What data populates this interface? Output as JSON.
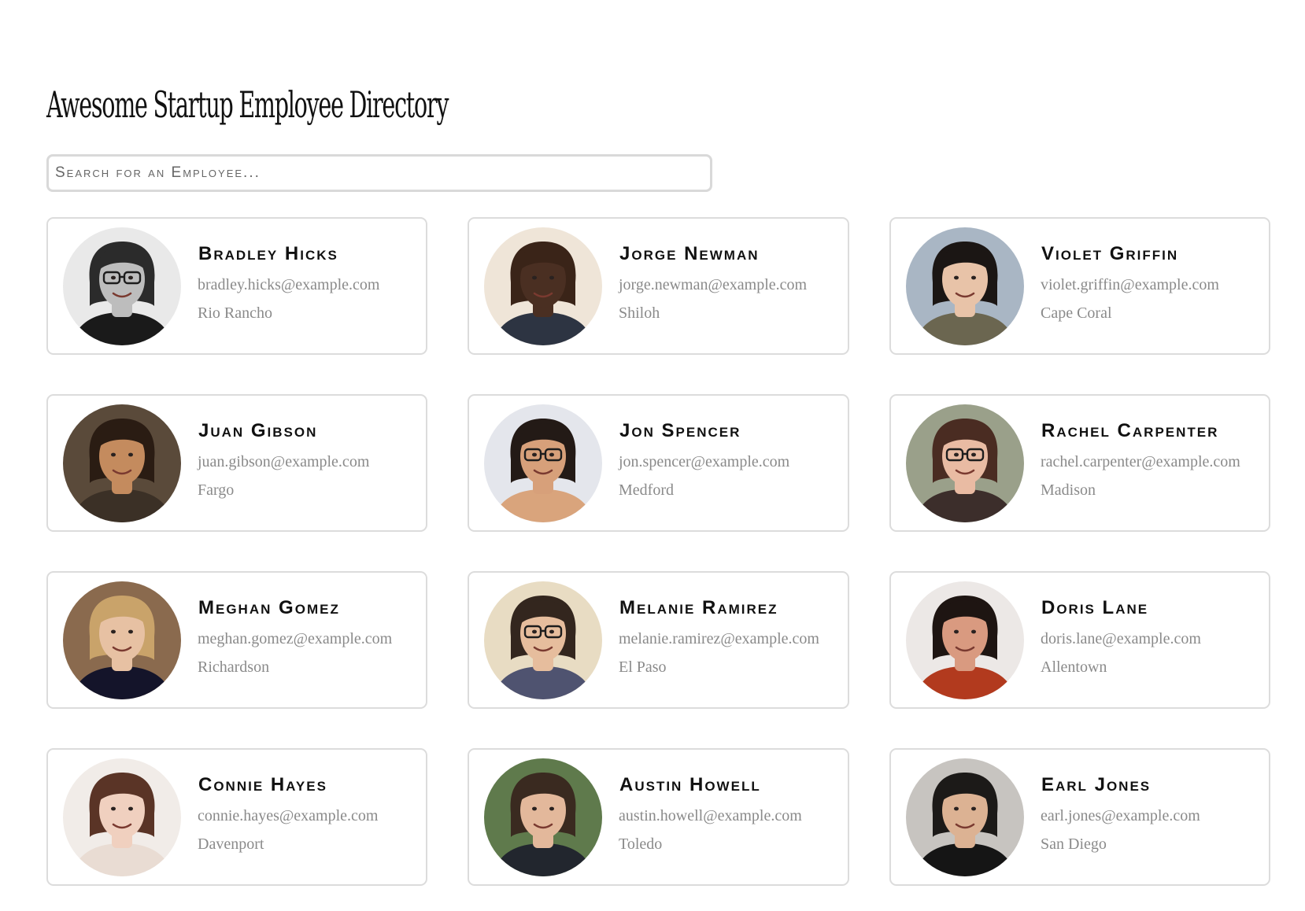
{
  "header": {
    "title": "Awesome Startup Employee Directory"
  },
  "search": {
    "placeholder": "Search for an Employee...",
    "value": ""
  },
  "employees": [
    {
      "name": "Bradley Hicks",
      "email": "bradley.hicks@example.com",
      "city": "Rio Rancho",
      "photo": {
        "bg": "#e9e9e9",
        "skin": "#bdbdbd",
        "hair": "#2b2b2b",
        "shirt": "#1a1a1a",
        "glasses": true
      }
    },
    {
      "name": "Jorge Newman",
      "email": "jorge.newman@example.com",
      "city": "Shiloh",
      "photo": {
        "bg": "#efe5d8",
        "skin": "#4a2f22",
        "hair": "#3a2418",
        "shirt": "#2d3442",
        "glasses": false
      }
    },
    {
      "name": "Violet Griffin",
      "email": "violet.griffin@example.com",
      "city": "Cape Coral",
      "photo": {
        "bg": "#a9b6c4",
        "skin": "#e8c3a8",
        "hair": "#1b1614",
        "shirt": "#6b6650",
        "glasses": false
      }
    },
    {
      "name": "Juan Gibson",
      "email": "juan.gibson@example.com",
      "city": "Fargo",
      "photo": {
        "bg": "#5a4a3a",
        "skin": "#c48b5e",
        "hair": "#2a1c13",
        "shirt": "#3b3026",
        "glasses": false
      }
    },
    {
      "name": "Jon Spencer",
      "email": "jon.spencer@example.com",
      "city": "Medford",
      "photo": {
        "bg": "#e4e6ec",
        "skin": "#d7a07a",
        "hair": "#231a16",
        "shirt": "#d9a47c",
        "glasses": true
      }
    },
    {
      "name": "Rachel Carpenter",
      "email": "rachel.carpenter@example.com",
      "city": "Madison",
      "photo": {
        "bg": "#9aa08a",
        "skin": "#e9bba3",
        "hair": "#4a2c22",
        "shirt": "#3c2e2b",
        "glasses": true
      }
    },
    {
      "name": "Meghan Gomez",
      "email": "meghan.gomez@example.com",
      "city": "Richardson",
      "photo": {
        "bg": "#8a6a4e",
        "skin": "#e7c1a3",
        "hair": "#c9a36a",
        "shirt": "#14142a",
        "glasses": false
      }
    },
    {
      "name": "Melanie Ramirez",
      "email": "melanie.ramirez@example.com",
      "city": "El Paso",
      "photo": {
        "bg": "#e8dcc3",
        "skin": "#e6bd9d",
        "hair": "#33261e",
        "shirt": "#4f5370",
        "glasses": true
      }
    },
    {
      "name": "Doris Lane",
      "email": "doris.lane@example.com",
      "city": "Allentown",
      "photo": {
        "bg": "#ece8e6",
        "skin": "#d99a80",
        "hair": "#1e1512",
        "shirt": "#b23a1e",
        "glasses": false
      }
    },
    {
      "name": "Connie Hayes",
      "email": "connie.hayes@example.com",
      "city": "Davenport",
      "photo": {
        "bg": "#f1ece8",
        "skin": "#f0d0bf",
        "hair": "#5a3426",
        "shirt": "#e9dcd3",
        "glasses": false
      }
    },
    {
      "name": "Austin Howell",
      "email": "austin.howell@example.com",
      "city": "Toledo",
      "photo": {
        "bg": "#5f7a4c",
        "skin": "#e3b89b",
        "hair": "#3a2a20",
        "shirt": "#22262e",
        "glasses": false
      }
    },
    {
      "name": "Earl Jones",
      "email": "earl.jones@example.com",
      "city": "San Diego",
      "photo": {
        "bg": "#c7c4c0",
        "skin": "#dcb293",
        "hair": "#1c1a18",
        "shirt": "#151515",
        "glasses": false
      }
    }
  ]
}
